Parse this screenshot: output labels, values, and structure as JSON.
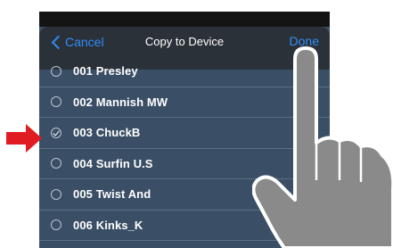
{
  "nav": {
    "cancel_label": "Cancel",
    "title": "Copy to Device",
    "done_label": "Done"
  },
  "list": {
    "items": [
      {
        "label": "001  Presley",
        "selected": false
      },
      {
        "label": "002 Mannish MW",
        "selected": false
      },
      {
        "label": "003 ChuckB",
        "selected": true
      },
      {
        "label": "004 Surfin U.S",
        "selected": false
      },
      {
        "label": "005 Twist And",
        "selected": false
      },
      {
        "label": "006 Kinks_K",
        "selected": false
      }
    ]
  },
  "colors": {
    "accent": "#2f8df7",
    "list_bg": "#3a4f66",
    "nav_bg": "#2b3138",
    "arrow": "#e11b22",
    "hand": "#8a8a8a"
  },
  "icons": {
    "back": "chevron-left-icon",
    "unchecked": "radio-empty-icon",
    "checked": "radio-checked-icon",
    "pointer": "red-arrow-icon",
    "hand": "pointing-hand-icon"
  }
}
